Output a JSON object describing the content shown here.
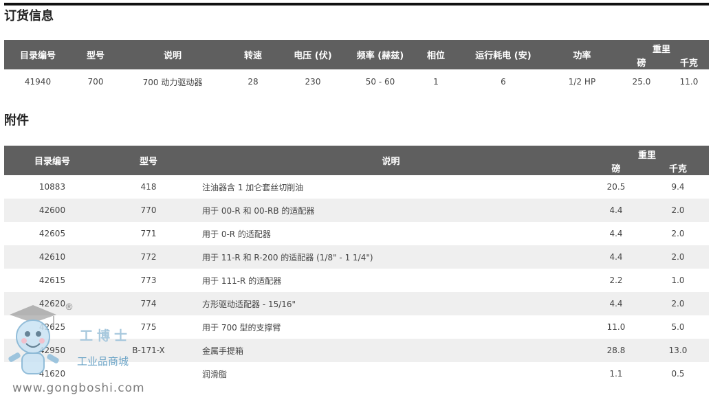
{
  "order": {
    "title": "订货信息",
    "headers": {
      "catalog": "目录编号",
      "model": "型号",
      "desc": "说明",
      "speed": "转速",
      "voltage": "电压 (伏)",
      "frequency": "频率 (赫兹)",
      "phase": "相位",
      "current": "运行耗电 (安)",
      "power": "功率",
      "weight": "重里",
      "lb": "磅",
      "kg": "千克"
    },
    "rows": [
      {
        "catalog": "41940",
        "model": "700",
        "desc": "700 动力驱动器",
        "speed": "28",
        "voltage": "230",
        "frequency": "50 - 60",
        "phase": "1",
        "current": "6",
        "power": "1/2 HP",
        "lb": "25.0",
        "kg": "11.0"
      }
    ]
  },
  "accessories": {
    "title": "附件",
    "headers": {
      "catalog": "目录编号",
      "model": "型号",
      "desc": "说明",
      "weight": "重里",
      "lb": "磅",
      "kg": "千克"
    },
    "rows": [
      {
        "catalog": "10883",
        "model": "418",
        "desc": "注油器含 1 加仑套丝切削油",
        "lb": "20.5",
        "kg": "9.4"
      },
      {
        "catalog": "42600",
        "model": "770",
        "desc": "用于 00-R 和 00-RB 的适配器",
        "lb": "4.4",
        "kg": "2.0"
      },
      {
        "catalog": "42605",
        "model": "771",
        "desc": "用于 0-R 的适配器",
        "lb": "4.4",
        "kg": "2.0"
      },
      {
        "catalog": "42610",
        "model": "772",
        "desc": "用于 11-R 和 R-200 的适配器 (1/8\" - 1 1/4\")",
        "lb": "4.4",
        "kg": "2.0"
      },
      {
        "catalog": "42615",
        "model": "773",
        "desc": "用于 111-R 的适配器",
        "lb": "2.2",
        "kg": "1.0"
      },
      {
        "catalog": "42620",
        "model": "774",
        "desc": "方形驱动适配器 - 15/16\"",
        "lb": "4.4",
        "kg": "2.0"
      },
      {
        "catalog": "42625",
        "model": "775",
        "desc": "用于 700 型的支撑臂",
        "lb": "11.0",
        "kg": "5.0"
      },
      {
        "catalog": "42950",
        "model": "B-171-X",
        "desc": "金属手提箱",
        "lb": "28.8",
        "kg": "13.0"
      },
      {
        "catalog": "41620",
        "model": "",
        "desc": "润滑脂",
        "lb": "1.1",
        "kg": "0.5"
      }
    ]
  },
  "watermark": {
    "brand": "工博士",
    "sub": "工业品商城",
    "url": "www.gongboshi.com",
    "reg": "®"
  }
}
